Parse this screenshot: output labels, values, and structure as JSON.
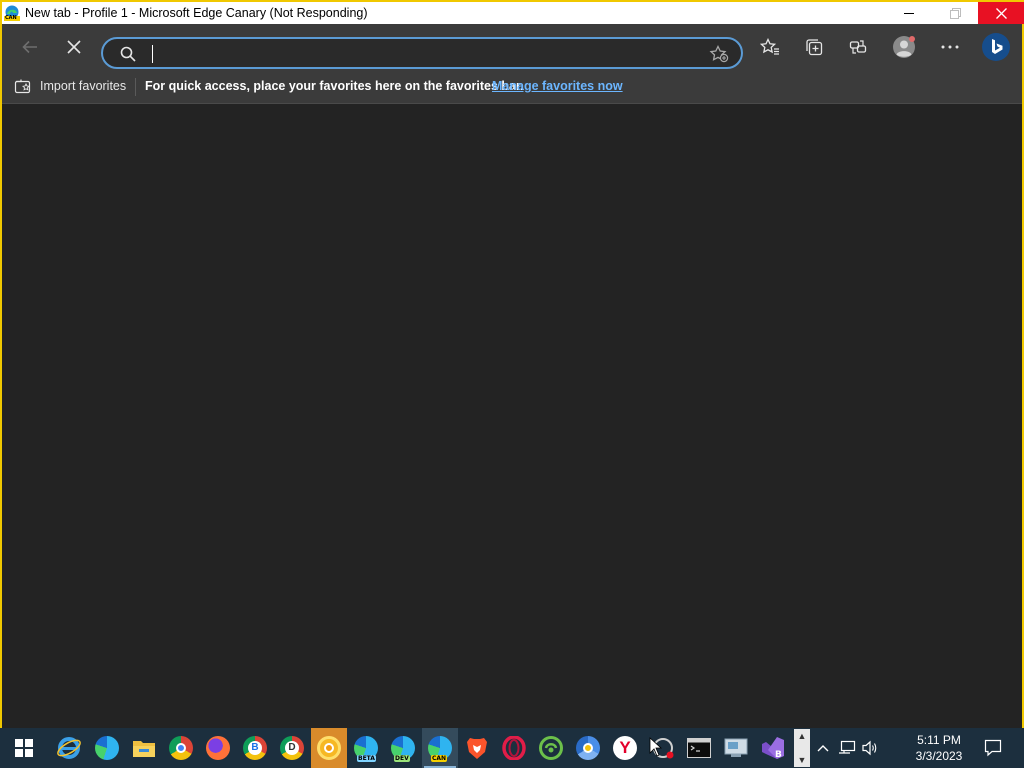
{
  "window": {
    "title": "New tab - Profile 1 - Microsoft Edge Canary (Not Responding)",
    "app_icon_label": "CAN",
    "controls": [
      "minimize-icon",
      "maximize-icon",
      "close-icon"
    ]
  },
  "toolbar": {
    "back_icon": "back-arrow-icon",
    "stop_icon": "stop-loading-icon",
    "address": {
      "value": "",
      "placeholder": ""
    },
    "search_icon": "search-icon",
    "add_favorite_icon": "star-add-icon",
    "right_icons": [
      "favorites-icon",
      "collections-icon",
      "share-icon",
      "profile-icon",
      "more-icon",
      "bing-icon"
    ]
  },
  "favorites_bar": {
    "import_label": "Import favorites",
    "hint": "For quick access, place your favorites here on the favorites bar.",
    "manage_link": "Manage favorites now"
  },
  "taskbar": {
    "apps": [
      {
        "name": "start",
        "icon": "windows-icon"
      },
      {
        "name": "internet-explorer",
        "icon": "ie-icon"
      },
      {
        "name": "edge",
        "icon": "edge-icon"
      },
      {
        "name": "file-explorer",
        "icon": "folder-icon"
      },
      {
        "name": "chrome",
        "icon": "chrome-icon"
      },
      {
        "name": "firefox",
        "icon": "firefox-icon"
      },
      {
        "name": "chrome-beta",
        "icon": "chrome-beta-icon",
        "badge": "B"
      },
      {
        "name": "chrome-dev",
        "icon": "chrome-dev-icon",
        "badge": "D"
      },
      {
        "name": "chrome-canary",
        "icon": "chrome-canary-icon"
      },
      {
        "name": "edge-beta",
        "icon": "edge-beta-icon",
        "badge": "BETA"
      },
      {
        "name": "edge-dev",
        "icon": "edge-dev-icon",
        "badge": "DEV"
      },
      {
        "name": "edge-canary",
        "icon": "edge-canary-icon",
        "badge": "CAN"
      },
      {
        "name": "brave",
        "icon": "brave-icon"
      },
      {
        "name": "opera",
        "icon": "opera-icon"
      },
      {
        "name": "cent-browser",
        "icon": "cent-browser-icon"
      },
      {
        "name": "chromium",
        "icon": "chromium-icon"
      },
      {
        "name": "yandex",
        "icon": "yandex-icon",
        "badge": "Y"
      },
      {
        "name": "unknown-app",
        "icon": "app-icon"
      },
      {
        "name": "terminal",
        "icon": "terminal-icon"
      },
      {
        "name": "control-panel",
        "icon": "control-panel-icon"
      },
      {
        "name": "visual-studio",
        "icon": "visual-studio-icon",
        "badge": "B"
      }
    ],
    "tray": {
      "chevron_icon": "chevron-up-icon",
      "network_icon": "network-icon",
      "volume_icon": "volume-icon",
      "time": "5:11 PM",
      "date": "3/3/2023",
      "notification_icon": "notification-icon"
    }
  },
  "colors": {
    "window_border": "#f0c800",
    "toolbar_bg": "#3b3b3b",
    "content_bg": "#232323",
    "address_focus": "#5b9bd5",
    "link": "#6cb6ff",
    "close_button": "#e81123",
    "taskbar_bg": "#1c2f3e"
  }
}
